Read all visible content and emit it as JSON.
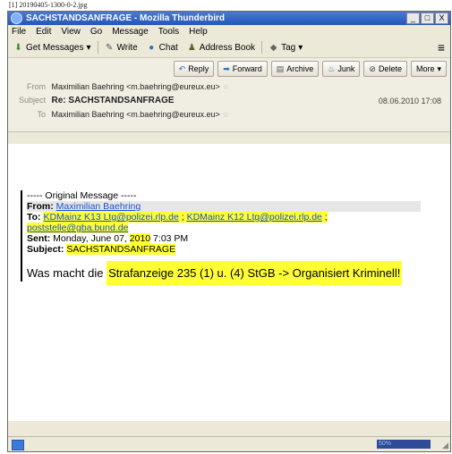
{
  "caption": "[1] 20190405-1300-0-2.jpg",
  "window": {
    "title": "SACHSTANDSANFRAGE - Mozilla Thunderbird",
    "btn_min": "_",
    "btn_max": "□",
    "btn_close": "X"
  },
  "menu": [
    "File",
    "Edit",
    "View",
    "Go",
    "Message",
    "Tools",
    "Help"
  ],
  "toolbar": {
    "get_messages": "Get Messages",
    "dropdown_arrow": "▾",
    "write": "Write",
    "chat": "Chat",
    "address_book": "Address Book",
    "tag": "Tag",
    "menu_glyph": "≡"
  },
  "actions": {
    "reply": "Reply",
    "forward": "Forward",
    "archive": "Archive",
    "junk": "Junk",
    "delete": "Delete",
    "more": "More"
  },
  "header": {
    "from_label": "From",
    "from_value": "Maximilian Baehring <m.baehring@eureux.eu>",
    "subject_label": "Subject",
    "subject_value": "Re: SACHSTANDSANFRAGE",
    "date": "08.06.2010 17:08",
    "to_label": "To",
    "to_value": "Maximilian Baehring <m.baehring@eureux.eu>"
  },
  "body": {
    "original_message": "----- Original Message -----",
    "from_label": "From:",
    "from_link": "Maximilian Baehring",
    "to_label": "To:",
    "to_link1": "KDMainz K13 Ltg@polizei.rlp.de",
    "to_sep1": " ; ",
    "to_link2": "KDMainz K12 Ltg@polizei.rlp.de",
    "to_sep2": " ;",
    "to_link3": "poststelle@gba.bund.de",
    "sent_label": "Sent:",
    "sent_value_pre": " Monday, June 07, ",
    "sent_value_year": "2010",
    "sent_value_post": " 7:03 PM",
    "subject_label": "Subject:",
    "subject_value": "SACHSTANDSANFRAGE",
    "line_pre": "Was macht die ",
    "line_hl": "Strafanzeige 235 (1) u. (4) StGB -> Organisiert Kriminell!"
  },
  "status": {
    "progress_text": "50%"
  },
  "colors": {
    "highlight": "#ffff33",
    "link": "#1a4fd1",
    "titlebar": "#2456b8"
  }
}
